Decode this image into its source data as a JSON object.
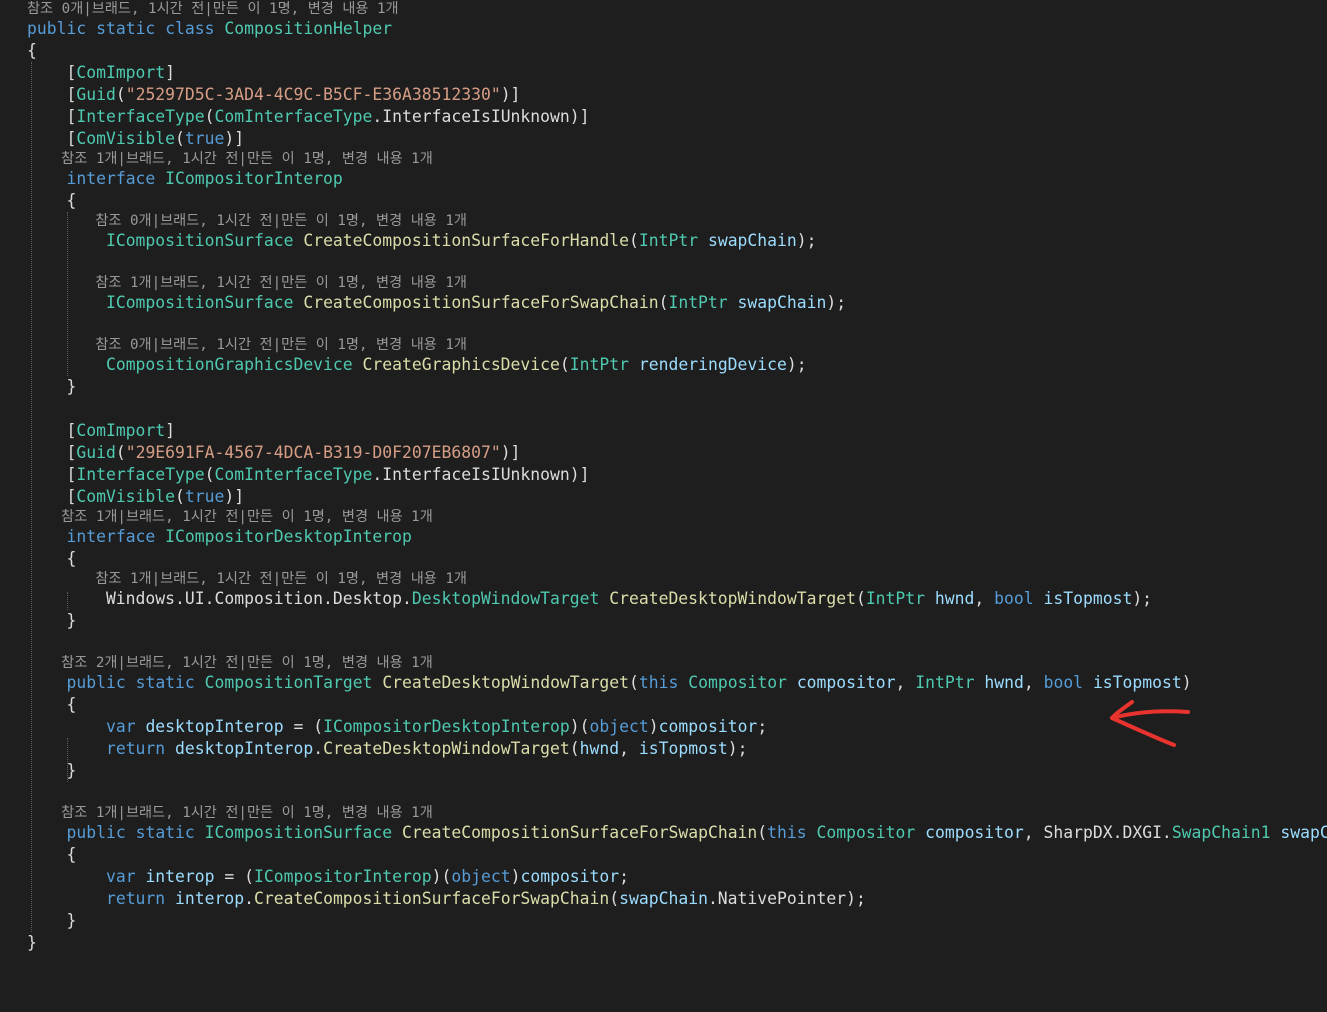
{
  "editor": {
    "lines": [
      {
        "kind": "lens",
        "tokens": [
          {
            "t": "lens",
            "v": "참조 0개|브래드, 1시간 전|만든 이 1명, 변경 내용 1개"
          }
        ]
      },
      {
        "kind": "code",
        "tokens": [
          {
            "t": "keyword",
            "v": "public"
          },
          {
            "t": "plain",
            "v": " "
          },
          {
            "t": "keyword",
            "v": "static"
          },
          {
            "t": "plain",
            "v": " "
          },
          {
            "t": "keyword",
            "v": "class"
          },
          {
            "t": "plain",
            "v": " "
          },
          {
            "t": "type",
            "v": "CompositionHelper"
          }
        ]
      },
      {
        "kind": "code",
        "tokens": [
          {
            "t": "plain",
            "v": "{"
          }
        ]
      },
      {
        "kind": "code",
        "tokens": [
          {
            "t": "plain",
            "v": "    ["
          },
          {
            "t": "type",
            "v": "ComImport"
          },
          {
            "t": "plain",
            "v": "]"
          }
        ]
      },
      {
        "kind": "code",
        "tokens": [
          {
            "t": "plain",
            "v": "    ["
          },
          {
            "t": "type",
            "v": "Guid"
          },
          {
            "t": "plain",
            "v": "("
          },
          {
            "t": "string",
            "v": "\"25297D5C-3AD4-4C9C-B5CF-E36A38512330\""
          },
          {
            "t": "plain",
            "v": ")]"
          }
        ]
      },
      {
        "kind": "code",
        "tokens": [
          {
            "t": "plain",
            "v": "    ["
          },
          {
            "t": "type",
            "v": "InterfaceType"
          },
          {
            "t": "plain",
            "v": "("
          },
          {
            "t": "type",
            "v": "ComInterfaceType"
          },
          {
            "t": "plain",
            "v": ".InterfaceIsIUnknown)]"
          }
        ]
      },
      {
        "kind": "code",
        "tokens": [
          {
            "t": "plain",
            "v": "    ["
          },
          {
            "t": "type",
            "v": "ComVisible"
          },
          {
            "t": "plain",
            "v": "("
          },
          {
            "t": "keyword",
            "v": "true"
          },
          {
            "t": "plain",
            "v": ")]"
          }
        ]
      },
      {
        "kind": "lens",
        "tokens": [
          {
            "t": "lens",
            "v": "    참조 1개|브래드, 1시간 전|만든 이 1명, 변경 내용 1개"
          }
        ]
      },
      {
        "kind": "code",
        "tokens": [
          {
            "t": "plain",
            "v": "    "
          },
          {
            "t": "keyword",
            "v": "interface"
          },
          {
            "t": "plain",
            "v": " "
          },
          {
            "t": "type",
            "v": "ICompositorInterop"
          }
        ]
      },
      {
        "kind": "code",
        "tokens": [
          {
            "t": "plain",
            "v": "    {"
          }
        ]
      },
      {
        "kind": "lens",
        "tokens": [
          {
            "t": "lens",
            "v": "        참조 0개|브래드, 1시간 전|만든 이 1명, 변경 내용 1개"
          }
        ]
      },
      {
        "kind": "code",
        "tokens": [
          {
            "t": "plain",
            "v": "        "
          },
          {
            "t": "type",
            "v": "ICompositionSurface"
          },
          {
            "t": "plain",
            "v": " "
          },
          {
            "t": "method",
            "v": "CreateCompositionSurfaceForHandle"
          },
          {
            "t": "plain",
            "v": "("
          },
          {
            "t": "type",
            "v": "IntPtr"
          },
          {
            "t": "plain",
            "v": " "
          },
          {
            "t": "param",
            "v": "swapChain"
          },
          {
            "t": "plain",
            "v": ");"
          }
        ]
      },
      {
        "kind": "blank",
        "tokens": []
      },
      {
        "kind": "lens",
        "tokens": [
          {
            "t": "lens",
            "v": "        참조 1개|브래드, 1시간 전|만든 이 1명, 변경 내용 1개"
          }
        ]
      },
      {
        "kind": "code",
        "tokens": [
          {
            "t": "plain",
            "v": "        "
          },
          {
            "t": "type",
            "v": "ICompositionSurface"
          },
          {
            "t": "plain",
            "v": " "
          },
          {
            "t": "method",
            "v": "CreateCompositionSurfaceForSwapChain"
          },
          {
            "t": "plain",
            "v": "("
          },
          {
            "t": "type",
            "v": "IntPtr"
          },
          {
            "t": "plain",
            "v": " "
          },
          {
            "t": "param",
            "v": "swapChain"
          },
          {
            "t": "plain",
            "v": ");"
          }
        ]
      },
      {
        "kind": "blank",
        "tokens": []
      },
      {
        "kind": "lens",
        "tokens": [
          {
            "t": "lens",
            "v": "        참조 0개|브래드, 1시간 전|만든 이 1명, 변경 내용 1개"
          }
        ]
      },
      {
        "kind": "code",
        "tokens": [
          {
            "t": "plain",
            "v": "        "
          },
          {
            "t": "type",
            "v": "CompositionGraphicsDevice"
          },
          {
            "t": "plain",
            "v": " "
          },
          {
            "t": "method",
            "v": "CreateGraphicsDevice"
          },
          {
            "t": "plain",
            "v": "("
          },
          {
            "t": "type",
            "v": "IntPtr"
          },
          {
            "t": "plain",
            "v": " "
          },
          {
            "t": "param",
            "v": "renderingDevice"
          },
          {
            "t": "plain",
            "v": ");"
          }
        ]
      },
      {
        "kind": "code",
        "tokens": [
          {
            "t": "plain",
            "v": "    }"
          }
        ]
      },
      {
        "kind": "blank",
        "tokens": []
      },
      {
        "kind": "code",
        "tokens": [
          {
            "t": "plain",
            "v": "    ["
          },
          {
            "t": "type",
            "v": "ComImport"
          },
          {
            "t": "plain",
            "v": "]"
          }
        ]
      },
      {
        "kind": "code",
        "tokens": [
          {
            "t": "plain",
            "v": "    ["
          },
          {
            "t": "type",
            "v": "Guid"
          },
          {
            "t": "plain",
            "v": "("
          },
          {
            "t": "string",
            "v": "\"29E691FA-4567-4DCA-B319-D0F207EB6807\""
          },
          {
            "t": "plain",
            "v": ")]"
          }
        ]
      },
      {
        "kind": "code",
        "tokens": [
          {
            "t": "plain",
            "v": "    ["
          },
          {
            "t": "type",
            "v": "InterfaceType"
          },
          {
            "t": "plain",
            "v": "("
          },
          {
            "t": "type",
            "v": "ComInterfaceType"
          },
          {
            "t": "plain",
            "v": ".InterfaceIsIUnknown)]"
          }
        ]
      },
      {
        "kind": "code",
        "tokens": [
          {
            "t": "plain",
            "v": "    ["
          },
          {
            "t": "type",
            "v": "ComVisible"
          },
          {
            "t": "plain",
            "v": "("
          },
          {
            "t": "keyword",
            "v": "true"
          },
          {
            "t": "plain",
            "v": ")]"
          }
        ]
      },
      {
        "kind": "lens",
        "tokens": [
          {
            "t": "lens",
            "v": "    참조 1개|브래드, 1시간 전|만든 이 1명, 변경 내용 1개"
          }
        ]
      },
      {
        "kind": "code",
        "tokens": [
          {
            "t": "plain",
            "v": "    "
          },
          {
            "t": "keyword",
            "v": "interface"
          },
          {
            "t": "plain",
            "v": " "
          },
          {
            "t": "type",
            "v": "ICompositorDesktopInterop"
          }
        ]
      },
      {
        "kind": "code",
        "tokens": [
          {
            "t": "plain",
            "v": "    {"
          }
        ]
      },
      {
        "kind": "lens",
        "tokens": [
          {
            "t": "lens",
            "v": "        참조 1개|브래드, 1시간 전|만든 이 1명, 변경 내용 1개"
          }
        ]
      },
      {
        "kind": "code",
        "tokens": [
          {
            "t": "plain",
            "v": "        Windows.UI.Composition.Desktop."
          },
          {
            "t": "type",
            "v": "DesktopWindowTarget"
          },
          {
            "t": "plain",
            "v": " "
          },
          {
            "t": "method",
            "v": "CreateDesktopWindowTarget"
          },
          {
            "t": "plain",
            "v": "("
          },
          {
            "t": "type",
            "v": "IntPtr"
          },
          {
            "t": "plain",
            "v": " "
          },
          {
            "t": "param",
            "v": "hwnd"
          },
          {
            "t": "plain",
            "v": ", "
          },
          {
            "t": "keyword",
            "v": "bool"
          },
          {
            "t": "plain",
            "v": " "
          },
          {
            "t": "param",
            "v": "isTopmost"
          },
          {
            "t": "plain",
            "v": ");"
          }
        ]
      },
      {
        "kind": "code",
        "tokens": [
          {
            "t": "plain",
            "v": "    }"
          }
        ]
      },
      {
        "kind": "blank",
        "tokens": []
      },
      {
        "kind": "lens",
        "tokens": [
          {
            "t": "lens",
            "v": "    참조 2개|브래드, 1시간 전|만든 이 1명, 변경 내용 1개"
          }
        ]
      },
      {
        "kind": "code",
        "tokens": [
          {
            "t": "plain",
            "v": "    "
          },
          {
            "t": "keyword",
            "v": "public"
          },
          {
            "t": "plain",
            "v": " "
          },
          {
            "t": "keyword",
            "v": "static"
          },
          {
            "t": "plain",
            "v": " "
          },
          {
            "t": "type",
            "v": "CompositionTarget"
          },
          {
            "t": "plain",
            "v": " "
          },
          {
            "t": "method",
            "v": "CreateDesktopWindowTarget"
          },
          {
            "t": "plain",
            "v": "("
          },
          {
            "t": "keyword",
            "v": "this"
          },
          {
            "t": "plain",
            "v": " "
          },
          {
            "t": "type",
            "v": "Compositor"
          },
          {
            "t": "plain",
            "v": " "
          },
          {
            "t": "param",
            "v": "compositor"
          },
          {
            "t": "plain",
            "v": ", "
          },
          {
            "t": "type",
            "v": "IntPtr"
          },
          {
            "t": "plain",
            "v": " "
          },
          {
            "t": "param",
            "v": "hwnd"
          },
          {
            "t": "plain",
            "v": ", "
          },
          {
            "t": "keyword",
            "v": "bool"
          },
          {
            "t": "plain",
            "v": " "
          },
          {
            "t": "param",
            "v": "isTopmost"
          },
          {
            "t": "plain",
            "v": ")"
          }
        ]
      },
      {
        "kind": "code",
        "tokens": [
          {
            "t": "plain",
            "v": "    {"
          }
        ]
      },
      {
        "kind": "code",
        "tokens": [
          {
            "t": "plain",
            "v": "        "
          },
          {
            "t": "keyword",
            "v": "var"
          },
          {
            "t": "plain",
            "v": " "
          },
          {
            "t": "param",
            "v": "desktopInterop"
          },
          {
            "t": "plain",
            "v": " = ("
          },
          {
            "t": "type",
            "v": "ICompositorDesktopInterop"
          },
          {
            "t": "plain",
            "v": ")("
          },
          {
            "t": "keyword",
            "v": "object"
          },
          {
            "t": "plain",
            "v": ")"
          },
          {
            "t": "param",
            "v": "compositor"
          },
          {
            "t": "plain",
            "v": ";"
          }
        ]
      },
      {
        "kind": "code",
        "tokens": [
          {
            "t": "plain",
            "v": "        "
          },
          {
            "t": "keyword",
            "v": "return"
          },
          {
            "t": "plain",
            "v": " "
          },
          {
            "t": "param",
            "v": "desktopInterop"
          },
          {
            "t": "plain",
            "v": "."
          },
          {
            "t": "method",
            "v": "CreateDesktopWindowTarget"
          },
          {
            "t": "plain",
            "v": "("
          },
          {
            "t": "param",
            "v": "hwnd"
          },
          {
            "t": "plain",
            "v": ", "
          },
          {
            "t": "param",
            "v": "isTopmost"
          },
          {
            "t": "plain",
            "v": ");"
          }
        ]
      },
      {
        "kind": "code",
        "tokens": [
          {
            "t": "plain",
            "v": "    }"
          }
        ]
      },
      {
        "kind": "blank",
        "tokens": []
      },
      {
        "kind": "lens",
        "tokens": [
          {
            "t": "lens",
            "v": "    참조 1개|브래드, 1시간 전|만든 이 1명, 변경 내용 1개"
          }
        ]
      },
      {
        "kind": "code",
        "tokens": [
          {
            "t": "plain",
            "v": "    "
          },
          {
            "t": "keyword",
            "v": "public"
          },
          {
            "t": "plain",
            "v": " "
          },
          {
            "t": "keyword",
            "v": "static"
          },
          {
            "t": "plain",
            "v": " "
          },
          {
            "t": "type",
            "v": "ICompositionSurface"
          },
          {
            "t": "plain",
            "v": " "
          },
          {
            "t": "method",
            "v": "CreateCompositionSurfaceForSwapChain"
          },
          {
            "t": "plain",
            "v": "("
          },
          {
            "t": "keyword",
            "v": "this"
          },
          {
            "t": "plain",
            "v": " "
          },
          {
            "t": "type",
            "v": "Compositor"
          },
          {
            "t": "plain",
            "v": " "
          },
          {
            "t": "param",
            "v": "compositor"
          },
          {
            "t": "plain",
            "v": ", SharpDX.DXGI."
          },
          {
            "t": "type",
            "v": "SwapChain1"
          },
          {
            "t": "plain",
            "v": " "
          },
          {
            "t": "param",
            "v": "swapChain"
          },
          {
            "t": "plain",
            "v": ")"
          }
        ]
      },
      {
        "kind": "code",
        "tokens": [
          {
            "t": "plain",
            "v": "    {"
          }
        ]
      },
      {
        "kind": "code",
        "tokens": [
          {
            "t": "plain",
            "v": "        "
          },
          {
            "t": "keyword",
            "v": "var"
          },
          {
            "t": "plain",
            "v": " "
          },
          {
            "t": "param",
            "v": "interop"
          },
          {
            "t": "plain",
            "v": " = ("
          },
          {
            "t": "type",
            "v": "ICompositorInterop"
          },
          {
            "t": "plain",
            "v": ")("
          },
          {
            "t": "keyword",
            "v": "object"
          },
          {
            "t": "plain",
            "v": ")"
          },
          {
            "t": "param",
            "v": "compositor"
          },
          {
            "t": "plain",
            "v": ";"
          }
        ]
      },
      {
        "kind": "code",
        "tokens": [
          {
            "t": "plain",
            "v": "        "
          },
          {
            "t": "keyword",
            "v": "return"
          },
          {
            "t": "plain",
            "v": " "
          },
          {
            "t": "param",
            "v": "interop"
          },
          {
            "t": "plain",
            "v": "."
          },
          {
            "t": "method",
            "v": "CreateCompositionSurfaceForSwapChain"
          },
          {
            "t": "plain",
            "v": "("
          },
          {
            "t": "param",
            "v": "swapChain"
          },
          {
            "t": "plain",
            "v": ".NativePointer);"
          }
        ]
      },
      {
        "kind": "code",
        "tokens": [
          {
            "t": "plain",
            "v": "    }"
          }
        ]
      },
      {
        "kind": "code",
        "tokens": [
          {
            "t": "plain",
            "v": "}"
          }
        ]
      }
    ]
  },
  "annotation": {
    "icon": "red-arrow-icon",
    "color": "#e8332e"
  },
  "colors": {
    "background": "#1e1e1e",
    "keyword": "#569cd6",
    "type": "#4ec9b0",
    "string": "#d69d85",
    "param": "#9cdcfe",
    "method": "#dcdcaa",
    "plain": "#dcdcdc",
    "lens": "#999999"
  }
}
